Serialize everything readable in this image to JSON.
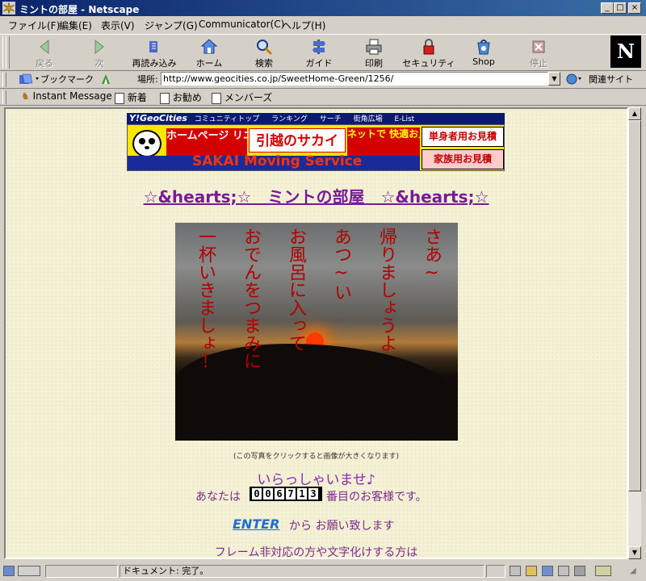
{
  "window": {
    "title": "ミントの部屋 - Netscape",
    "buttons": {
      "minimize": "_",
      "maximize": "□",
      "close": "×"
    }
  },
  "menu": [
    "ファイル(F)",
    "編集(E)",
    "表示(V)",
    "ジャンプ(G)",
    "Communicator(C)",
    "ヘルプ(H)"
  ],
  "toolbar": {
    "items": [
      {
        "label": "戻る",
        "icon": "back-arrow-icon",
        "enabled": false
      },
      {
        "label": "次",
        "icon": "forward-arrow-icon",
        "enabled": false
      },
      {
        "label": "再読み込み",
        "icon": "reload-icon",
        "enabled": true
      },
      {
        "label": "ホーム",
        "icon": "home-icon",
        "enabled": true
      },
      {
        "label": "検索",
        "icon": "search-icon",
        "enabled": true
      },
      {
        "label": "ガイド",
        "icon": "guide-icon",
        "enabled": true
      },
      {
        "label": "印刷",
        "icon": "printer-icon",
        "enabled": true
      },
      {
        "label": "セキュリティ",
        "icon": "lock-icon",
        "enabled": true
      },
      {
        "label": "Shop",
        "icon": "shop-icon",
        "enabled": true
      },
      {
        "label": "停止",
        "icon": "stop-icon",
        "enabled": false
      }
    ],
    "logo": "N"
  },
  "location": {
    "bookmarks_label": "ブックマーク",
    "location_label": "場所:",
    "url": "http://www.geocities.co.jp/SweetHome-Green/1256/",
    "related_label": "関連サイト"
  },
  "personal_bar": [
    "Instant Message",
    "新着",
    "お勧め",
    "メンバーズ"
  ],
  "page": {
    "geo_bar": {
      "logo": "Y!GeoCities",
      "links": [
        "コミュニティトップ",
        "ランキング",
        "サーチ",
        "街角広場",
        "E-List"
      ]
    },
    "ad": {
      "red_left": "ホームページ リニューアル!",
      "company": "引越のサカイ",
      "red_right": "ネットで 快適お見積",
      "button_single": "単身者用お見積",
      "button_family": "家族用お見積",
      "moving_text": "SAKAI Moving Service"
    },
    "title": "☆&hearts;☆　ミントの部屋　☆&hearts;☆",
    "poem_lines": [
      "さあ~",
      "帰りましょうよ",
      "あつ~い",
      "お風呂に入って",
      "おでんをつまみに",
      "一杯いきましょ!"
    ],
    "caption": "(この写真をクリックすると画像が大きくなります)",
    "welcome": "いらっしゃいませ♪",
    "visitor_prefix": "あなたは",
    "counter_digits": [
      "0",
      "0",
      "6",
      "7",
      "1",
      "3"
    ],
    "visitor_suffix": "番目のお客様です。",
    "enter_link": "ENTER",
    "enter_rest": "から お願い致します",
    "frame_note": "フレーム非対応の方や文字化けする方は"
  },
  "status": {
    "text": "ドキュメント: 完了。"
  },
  "colors": {
    "title_bar": "#0a246a",
    "page_bg": "#f5f1d6",
    "heading": "#7a1a9a",
    "link": "#1e6ed0",
    "poem": "#b00000"
  }
}
